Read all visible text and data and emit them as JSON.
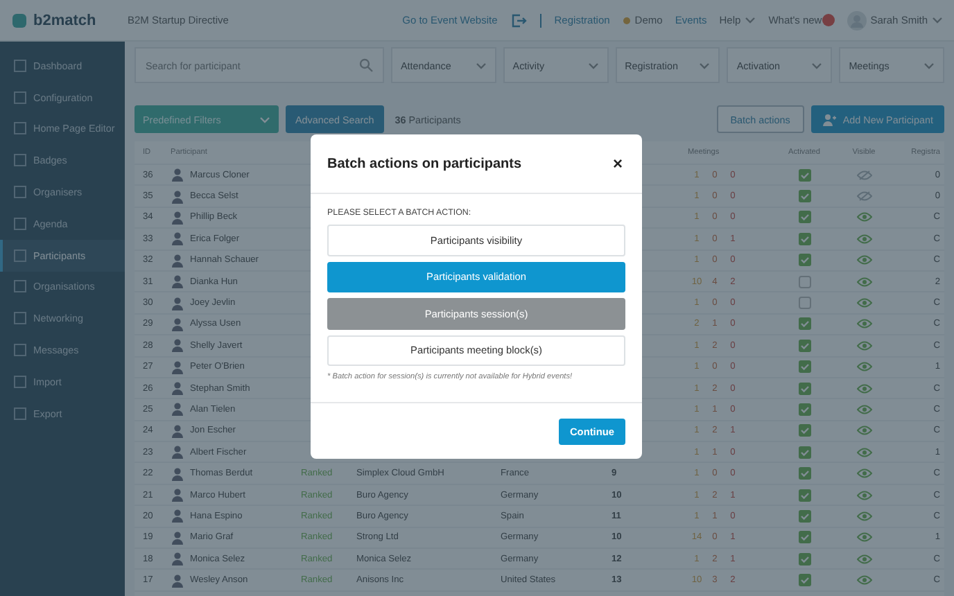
{
  "header": {
    "brand": "b2match",
    "event": "B2M Startup Directive",
    "links": [
      {
        "label": "Go to Event Website",
        "kind": "link"
      },
      {
        "label": "Registration",
        "kind": "link"
      },
      {
        "label": "Demo",
        "kind": "status"
      },
      {
        "label": "Events",
        "kind": "link"
      },
      {
        "label": "Help",
        "kind": "menu"
      },
      {
        "label": "What's new",
        "kind": "news"
      }
    ],
    "user": "Sarah Smith"
  },
  "sidebar": {
    "items": [
      {
        "label": "Dashboard",
        "selected": false
      },
      {
        "label": "Configuration",
        "selected": false
      },
      {
        "label": "Home Page Editor",
        "selected": false
      },
      {
        "label": "Badges",
        "selected": false
      },
      {
        "label": "Organisers",
        "selected": false
      },
      {
        "label": "Agenda",
        "selected": false
      },
      {
        "label": "Participants",
        "selected": true
      },
      {
        "label": "Organisations",
        "selected": false
      },
      {
        "label": "Networking",
        "selected": false
      },
      {
        "label": "Messages",
        "selected": false
      },
      {
        "label": "Import",
        "selected": false
      },
      {
        "label": "Export",
        "selected": false
      }
    ]
  },
  "filters": {
    "search": {
      "placeholder": "Search for participant"
    },
    "dropdowns": [
      "Attendance",
      "Activity",
      "Registration",
      "Activation",
      "Meetings"
    ]
  },
  "toolbar": {
    "predefined": "Predefined Filters",
    "advanced": "Advanced Search",
    "count": "**36** Participants",
    "batch": "Batch actions",
    "add": "Add New Participant"
  },
  "table": {
    "columns": [
      "ID",
      "Participant",
      "Meetings",
      "Activated",
      "Visible",
      "Registra"
    ],
    "rows": [
      {
        "id": "36",
        "name": "Marcus Cloner",
        "meetings": [
          "1",
          "0",
          "0"
        ],
        "activated": true,
        "visible": false,
        "column_10": "0"
      },
      {
        "id": "35",
        "name": "Becca Selst",
        "meetings": [
          "1",
          "0",
          "0"
        ],
        "activated": true,
        "visible": false,
        "column_10": "0"
      },
      {
        "id": "34",
        "name": "Phillip Beck",
        "meetings": [
          "1",
          "0",
          "0"
        ],
        "activated": true,
        "visible": true,
        "column_10": "C"
      },
      {
        "id": "33",
        "name": "Erica Folger",
        "meetings": [
          "1",
          "0",
          "1"
        ],
        "activated": true,
        "visible": true,
        "column_10": "C"
      },
      {
        "id": "32",
        "name": "Hannah Schauer",
        "meetings": [
          "1",
          "0",
          "0"
        ],
        "activated": true,
        "visible": true,
        "column_10": "C"
      },
      {
        "id": "31",
        "name": "Dianka Hun",
        "meetings": [
          "10",
          "4",
          "2"
        ],
        "activated": false,
        "visible": true,
        "column_10": "2"
      },
      {
        "id": "30",
        "name": "Joey Jevlin",
        "meetings": [
          "1",
          "0",
          "0"
        ],
        "activated": false,
        "visible": true,
        "column_10": "C"
      },
      {
        "id": "29",
        "name": "Alyssa Usen",
        "meetings": [
          "2",
          "1",
          "0"
        ],
        "activated": true,
        "visible": true,
        "column_10": "C"
      },
      {
        "id": "28",
        "name": "Shelly Javert",
        "meetings": [
          "1",
          "2",
          "0"
        ],
        "activated": true,
        "visible": true,
        "column_10": "C"
      },
      {
        "id": "27",
        "name": "Peter O'Brien",
        "meetings": [
          "1",
          "0",
          "0"
        ],
        "activated": true,
        "visible": true,
        "column_10": "1"
      },
      {
        "id": "26",
        "name": "Stephan Smith",
        "meetings": [
          "1",
          "2",
          "0"
        ],
        "activated": true,
        "visible": true,
        "column_10": "C"
      },
      {
        "id": "25",
        "name": "Alan Tielen",
        "meetings": [
          "1",
          "1",
          "0"
        ],
        "activated": true,
        "visible": true,
        "column_10": "C"
      },
      {
        "id": "24",
        "name": "Jon Escher",
        "meetings": [
          "1",
          "2",
          "1"
        ],
        "activated": true,
        "visible": true,
        "column_10": "C"
      },
      {
        "id": "23",
        "name": "Albert Fischer",
        "meetings": [
          "1",
          "1",
          "0"
        ],
        "activated": true,
        "visible": true,
        "column_10": "1"
      },
      {
        "id": "22",
        "name": "Thomas Berdut",
        "status": "Ranked",
        "organization": "Simplex Cloud GmbH",
        "country": "France",
        "column_6": "9",
        "meetings": [
          "1",
          "0",
          "0"
        ],
        "activated": true,
        "visible": true,
        "column_10": "C"
      },
      {
        "id": "21",
        "name": "Marco Hubert",
        "status": "Ranked",
        "organization": "Buro Agency",
        "country": "Germany",
        "column_6": "10",
        "meetings": [
          "1",
          "2",
          "1"
        ],
        "activated": true,
        "visible": true,
        "column_10": "C"
      },
      {
        "id": "20",
        "name": "Hana Espino",
        "status": "Ranked",
        "organization": "Buro Agency",
        "country": "Spain",
        "column_6": "11",
        "meetings": [
          "1",
          "1",
          "0"
        ],
        "activated": true,
        "visible": true,
        "column_10": "C"
      },
      {
        "id": "19",
        "name": "Mario Graf",
        "status": "Ranked",
        "organization": "Strong Ltd",
        "country": "Germany",
        "column_6": "10",
        "meetings": [
          "14",
          "0",
          "1"
        ],
        "activated": true,
        "visible": true,
        "column_10": "1"
      },
      {
        "id": "18",
        "name": "Monica Selez",
        "status": "Ranked",
        "organization": "Monica Selez",
        "country": "Germany",
        "column_6": "12",
        "meetings": [
          "1",
          "2",
          "1"
        ],
        "activated": true,
        "visible": true,
        "column_10": "C"
      },
      {
        "id": "17",
        "name": "Wesley Anson",
        "status": "Ranked",
        "organization": "Anisons Inc",
        "country": "United States",
        "column_6": "13",
        "meetings": [
          "10",
          "3",
          "2"
        ],
        "activated": true,
        "visible": true,
        "column_10": "C"
      }
    ]
  },
  "modal": {
    "title": "Batch actions on participants",
    "close": "×",
    "prompt": "PLEASE SELECT A BATCH ACTION:",
    "options": [
      {
        "label": "Participants visibility",
        "selected": false,
        "disabled": false
      },
      {
        "label": "Participants validation",
        "selected": true,
        "disabled": false
      },
      {
        "label": "Participants session(s)",
        "selected": false,
        "disabled": true
      },
      {
        "label": "Participants meeting block(s)",
        "selected": false,
        "disabled": false
      }
    ],
    "note": "* Batch action for session(s) is currently not available for Hybrid events!",
    "continue": "Continue"
  }
}
